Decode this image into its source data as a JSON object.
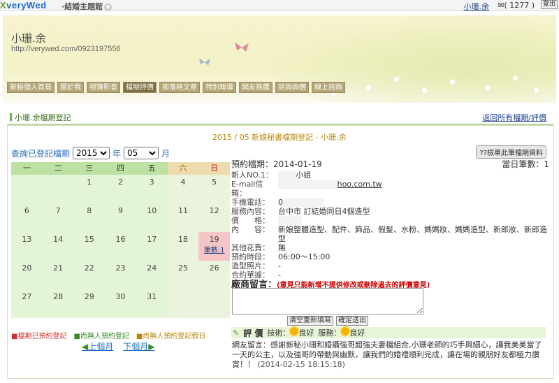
{
  "topbar": {
    "logo": "veryWed",
    "logo_prefix": "X",
    "theme_menu": "結婚主題館",
    "user_name": "小珊.余",
    "mail_count": "( 1277 )",
    "logout": "登出"
  },
  "site": {
    "title": "小珊.余",
    "url": "http://verywed.com/0923197556"
  },
  "nav": [
    "新秘個人首頁",
    "關於我",
    "相簿影音",
    "檔期評價",
    "部落格文章",
    "特別報導",
    "網友推薦",
    "諮詢詢價",
    "線上諮詢"
  ],
  "nav_active_index": 3,
  "breadcrumb": "小珊.余檔期登記",
  "back_link": "返回所有檔期/評價",
  "calendar": {
    "title": "2015 / 05 新娘秘書檔期登記 - 小珊.余",
    "query_label": "查詢已登記檔期",
    "year_value": "2015",
    "year_unit": "年",
    "month_value": "05",
    "month_unit": "月",
    "weekdays": [
      "一",
      "二",
      "三",
      "四",
      "五",
      "六",
      "日"
    ],
    "weeks": [
      [
        "",
        "",
        "",
        "1",
        "2",
        "3",
        "4",
        "5"
      ],
      [
        "6",
        "7",
        "8",
        "9",
        "10",
        "11",
        "12"
      ],
      [
        "13",
        "14",
        "15",
        "16",
        "17",
        "18",
        "19"
      ],
      [
        "20",
        "21",
        "22",
        "23",
        "24",
        "25",
        "26"
      ],
      [
        "27",
        "28",
        "29",
        "30",
        "31",
        "",
        ""
      ]
    ],
    "booked_day": "19",
    "booked_count_label": "筆數:1",
    "legend": [
      "■檔期已預約登記",
      "■尚無人預約登記",
      "■尚無人預約登記假日"
    ],
    "prev_month": "上個月",
    "next_month": "下個月"
  },
  "detail": {
    "detail_button": "??檢單此筆檔期資料",
    "booking_label": "預約檔期：",
    "booking_date": "2014-01-19",
    "daily_count_label": "當日筆數：",
    "daily_count": "1",
    "fields": [
      {
        "k": "新人NO.1：",
        "v": "小姐",
        "redacted": true
      },
      {
        "k": "E-mail信箱：",
        "v": "hoo.com.tw",
        "redacted": true
      },
      {
        "k": "手機電話：",
        "v": "0",
        "redacted": true
      },
      {
        "k": "服務內容：",
        "v": "台中市 訂結婚同日4個造型"
      },
      {
        "k": "價　　格：",
        "v": "",
        "redacted": true
      },
      {
        "k": "內　　容：",
        "v": "新娘整體造型、配件、飾品、假髮、水粉、媽媽妝、媽媽造型、新郎妝、新郎造型"
      },
      {
        "k": "其他花費：",
        "v": "無"
      },
      {
        "k": "預約時段：",
        "v": "06:00～15:00"
      },
      {
        "k": "造型照片：",
        "v": "-"
      },
      {
        "k": "合約單據：",
        "v": "-"
      }
    ]
  },
  "message": {
    "title": "廠商留言：",
    "note": "(意見只能新增不提供修改或刪除過去的評價意見)",
    "clear_button": "清空重新填寫",
    "submit_button": "確定送出"
  },
  "evaluation": {
    "title": "評 價",
    "tech_label": "技術：",
    "tech_value": "良好",
    "service_label": "服務：",
    "service_value": "良好",
    "comment": "網友留言：感謝新秘小珊和婚攝強哥超強夫妻檔組合,小珊老師的巧手與細心，讓我美美當了一天的公主，以及強哥的帶動與幽默，讓我們的婚禮順利完成，讓在場的親朋好友都極力讚賞！！",
    "comment_time": "(2014-02-15 18:15:18)"
  },
  "colors": {
    "accent_blue": "#1a6fc4",
    "green": "#3a8a2c",
    "booked_pink": "#f6c6c6",
    "nav_brown": "#b5a677"
  }
}
